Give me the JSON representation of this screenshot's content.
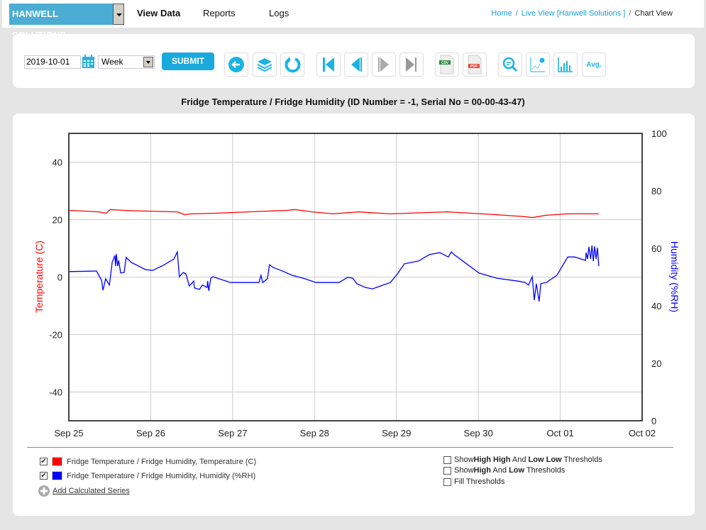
{
  "topbar": {
    "brand": "HANWELL SOLUTIONS",
    "nav": [
      "View Data",
      "Reports",
      "Logs"
    ],
    "breadcrumb": [
      "Home",
      "Live View [Hanwell Solutions ]",
      "Chart View"
    ]
  },
  "toolbar": {
    "date": "2019-10-01",
    "period": "Week",
    "submit": "SUBMIT",
    "buttons": [
      "back-icon",
      "layers-icon",
      "refresh-icon",
      "first-icon",
      "previous-icon",
      "next-icon",
      "last-icon",
      "csv-icon",
      "pdf-icon",
      "zoom-icon",
      "chart-settings-icon",
      "bar-chart-icon",
      "average-icon"
    ],
    "avg_label": "Avg.",
    "csv_label": "CSV",
    "pdf_label": "PDF"
  },
  "chart_title": "Fridge Temperature / Fridge Humidity (ID Number = -1, Serial No = 00-00-43-47)",
  "chart_data": {
    "type": "line",
    "x_ticks": [
      "Sep 25",
      "Sep 26",
      "Sep 27",
      "Sep 28",
      "Sep 29",
      "Sep 30",
      "Oct 01",
      "Oct 02"
    ],
    "xlim": [
      "2019-09-25T00:00",
      "2019-10-02T00:00"
    ],
    "y_left": {
      "label": "Temperature (C)",
      "ticks": [
        40,
        20,
        0,
        -20,
        -40
      ],
      "range": [
        -50,
        50
      ],
      "color": "#ff0000"
    },
    "y_right": {
      "label": "Humidity (%RH)",
      "ticks": [
        100,
        80,
        60,
        40,
        20,
        0
      ],
      "range": [
        0,
        100
      ],
      "color": "#0000ff"
    },
    "grid": true,
    "series": [
      {
        "name": "Fridge Temperature / Fridge Humidity, Temperature (C)",
        "axis": "left",
        "color": "#ff0000",
        "x": [
          "2019-09-25T00:00",
          "2019-09-25T08:54",
          "2019-09-25T11:00",
          "2019-09-25T12:06",
          "2019-09-25T16:12",
          "2019-09-25T21:24",
          "2019-09-26T07:48",
          "2019-09-26T09:54",
          "2019-09-26T12:00",
          "2019-09-26T18:12",
          "2019-09-27T04:36",
          "2019-09-27T16:00",
          "2019-09-27T18:06",
          "2019-09-27T23:18",
          "2019-09-28T05:30",
          "2019-09-28T12:48",
          "2019-09-28T22:12",
          "2019-09-29T14:48",
          "2019-09-30T05:24",
          "2019-09-30T13:42",
          "2019-09-30T15:48",
          "2019-09-30T19:54",
          "2019-10-01T02:12",
          "2019-10-01T11:18"
        ],
        "y": [
          23.2,
          22.7,
          22.2,
          23.5,
          23.2,
          23.0,
          22.7,
          21.7,
          22.0,
          22.2,
          22.7,
          23.2,
          23.5,
          22.7,
          22.0,
          22.7,
          22.0,
          22.7,
          21.7,
          21.0,
          20.7,
          21.5,
          22.0,
          22.0
        ]
      },
      {
        "name": "Fridge Temperature / Fridge Humidity, Humidity (%RH)",
        "axis": "right",
        "color": "#0000ff",
        "x": [
          "2019-09-25T00:00",
          "2019-09-25T08:06",
          "2019-09-25T09:36",
          "2019-09-25T10:00",
          "2019-09-25T10:48",
          "2019-09-25T11:54",
          "2019-09-25T12:42",
          "2019-09-25T13:30",
          "2019-09-25T13:42",
          "2019-09-25T13:54",
          "2019-09-25T14:18",
          "2019-09-25T14:36",
          "2019-09-25T15:12",
          "2019-09-25T16:12",
          "2019-09-25T16:48",
          "2019-09-25T18:18",
          "2019-09-25T22:30",
          "2019-09-26T00:30",
          "2019-09-26T03:42",
          "2019-09-26T06:48",
          "2019-09-26T07:48",
          "2019-09-26T08:24",
          "2019-09-26T09:30",
          "2019-09-26T10:18",
          "2019-09-26T11:18",
          "2019-09-26T12:36",
          "2019-09-26T12:48",
          "2019-09-26T14:18",
          "2019-09-26T15:06",
          "2019-09-26T16:30",
          "2019-09-26T16:42",
          "2019-09-26T17:00",
          "2019-09-26T17:36",
          "2019-09-26T18:12",
          "2019-09-26T23:24",
          "2019-09-27T07:42",
          "2019-09-27T08:18",
          "2019-09-27T08:48",
          "2019-09-27T10:12",
          "2019-09-27T10:48",
          "2019-09-27T11:54",
          "2019-09-27T14:12",
          "2019-09-27T17:30",
          "2019-09-27T21:12",
          "2019-09-28T00:24",
          "2019-09-28T07:12",
          "2019-09-28T09:42",
          "2019-09-28T11:12",
          "2019-09-28T12:24",
          "2019-09-28T14:54",
          "2019-09-28T17:00",
          "2019-09-28T19:18",
          "2019-09-28T22:12",
          "2019-09-29T00:18",
          "2019-09-29T02:18",
          "2019-09-29T06:30",
          "2019-09-29T09:36",
          "2019-09-29T12:42",
          "2019-09-29T15:12",
          "2019-09-29T16:06",
          "2019-09-29T16:54",
          "2019-09-29T20:00",
          "2019-09-30T00:12",
          "2019-09-30T05:24",
          "2019-09-30T11:36",
          "2019-09-30T13:42",
          "2019-09-30T14:42",
          "2019-09-30T15:48",
          "2019-09-30T16:24",
          "2019-09-30T17:00",
          "2019-09-30T17:48",
          "2019-09-30T18:18",
          "2019-09-30T19:54",
          "2019-09-30T23:00",
          "2019-10-01T02:12",
          "2019-10-01T04:12",
          "2019-10-01T07:24",
          "2019-10-01T07:36",
          "2019-10-01T08:00",
          "2019-10-01T08:24",
          "2019-10-01T08:54",
          "2019-10-01T09:18",
          "2019-10-01T09:42",
          "2019-10-01T10:06",
          "2019-10-01T10:30",
          "2019-10-01T10:54",
          "2019-10-01T11:18"
        ],
        "y": [
          51.9,
          52.1,
          48.9,
          45.4,
          49.4,
          47.2,
          55.1,
          57.5,
          53.8,
          58.0,
          53.8,
          55.8,
          51.4,
          51.6,
          56.8,
          55.1,
          52.6,
          52.3,
          54.1,
          56.3,
          58.8,
          50.1,
          51.6,
          51.1,
          46.9,
          48.6,
          46.2,
          45.7,
          47.2,
          46.4,
          48.6,
          45.2,
          49.6,
          50.1,
          48.1,
          48.1,
          50.6,
          48.1,
          49.4,
          54.3,
          53.3,
          52.3,
          50.6,
          49.4,
          48.1,
          48.1,
          49.9,
          49.6,
          47.7,
          46.4,
          45.9,
          46.9,
          48.1,
          51.1,
          54.6,
          55.6,
          57.8,
          58.5,
          57.0,
          58.8,
          57.8,
          55.1,
          51.4,
          49.6,
          48.6,
          48.1,
          47.2,
          50.1,
          42.0,
          47.7,
          41.5,
          47.7,
          48.1,
          50.6,
          57.0,
          57.0,
          55.8,
          58.5,
          56.3,
          60.5,
          56.3,
          61.0,
          55.6,
          60.7,
          56.3,
          60.2,
          53.8
        ]
      }
    ]
  },
  "legend": {
    "items": [
      {
        "label": "Fridge Temperature / Fridge Humidity, Temperature (C)",
        "checked": true,
        "color": "#ff0000"
      },
      {
        "label": "Fridge Temperature / Fridge Humidity, Humidity (%RH)",
        "checked": true,
        "color": "#0000ff"
      }
    ],
    "add_series": "Add Calculated Series"
  },
  "thresholds": {
    "hh": {
      "pre": "Show ",
      "b1": "High High",
      "mid": " And ",
      "b2": "Low Low",
      "post": " Thresholds"
    },
    "h": {
      "pre": "Show ",
      "b1": "High",
      "mid": " And ",
      "b2": "Low",
      "post": " Thresholds"
    },
    "fill": "Fill Thresholds"
  }
}
